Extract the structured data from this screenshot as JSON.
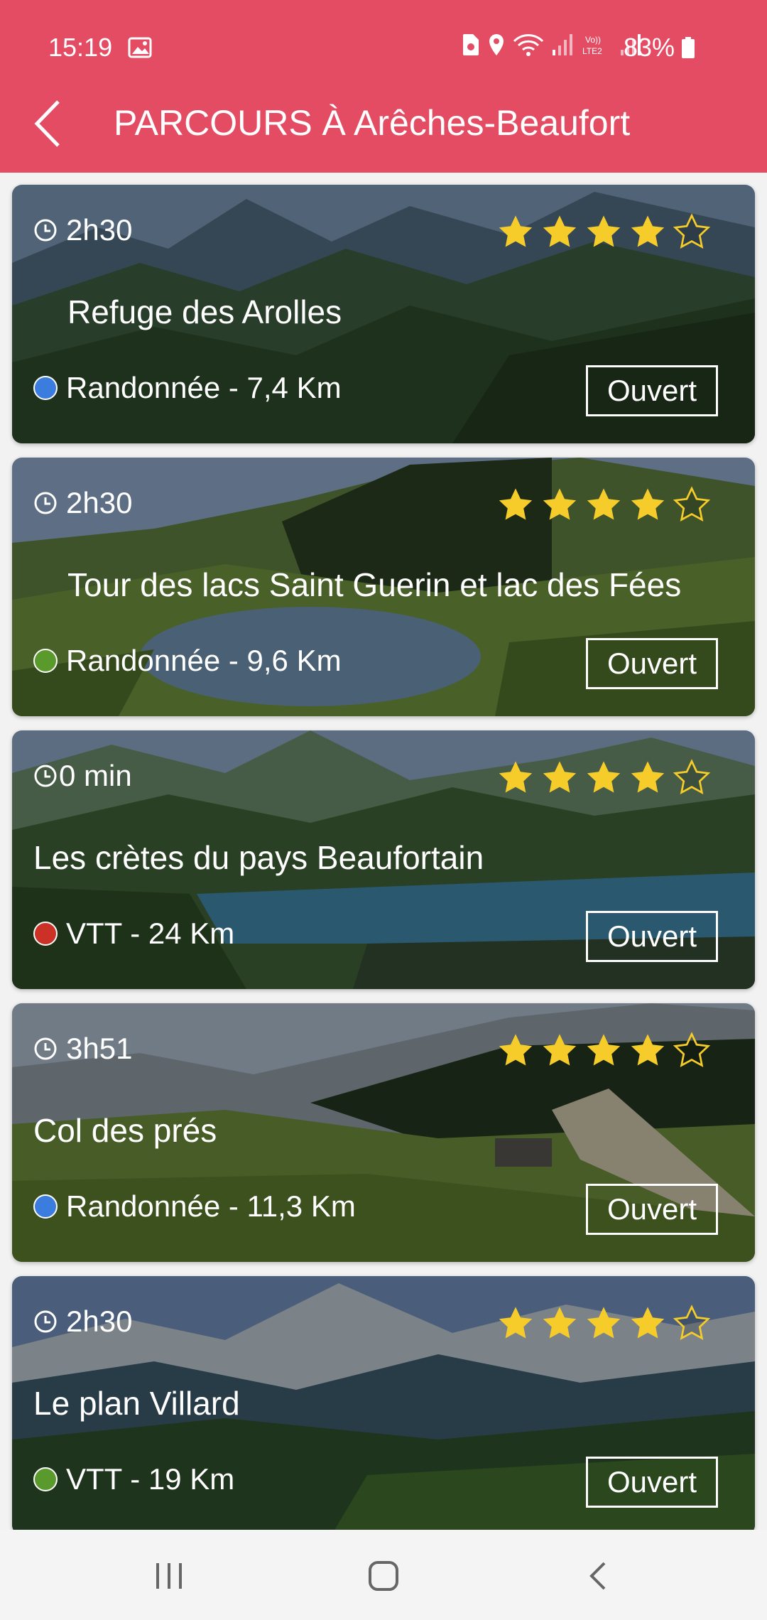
{
  "status_bar": {
    "time": "15:19",
    "battery": "83%"
  },
  "header": {
    "title": "PARCOURS À Arêches-Beaufort"
  },
  "routes": [
    {
      "duration": "2h30",
      "title": "Refuge des Arolles",
      "meta": "Randonnée - 7,4 Km",
      "dot_color": "#3b7cdf",
      "status": "Ouvert",
      "rating": 4
    },
    {
      "duration": "2h30",
      "title": "Tour des lacs Saint Guerin et lac des Fées",
      "meta": "Randonnée - 9,6 Km",
      "dot_color": "#5a9a2c",
      "status": "Ouvert",
      "rating": 4
    },
    {
      "duration": "0 min",
      "title": "Les crètes du pays Beaufortain",
      "meta": "VTT - 24 Km",
      "dot_color": "#cc3128",
      "status": "Ouvert",
      "rating": 4
    },
    {
      "duration": "3h51",
      "title": "Col des prés",
      "meta": "Randonnée - 11,3 Km",
      "dot_color": "#3b7cdf",
      "status": "Ouvert",
      "rating": 4
    },
    {
      "duration": "2h30",
      "title": "Le plan Villard",
      "meta": "VTT - 19 Km",
      "dot_color": "#5a9a2c",
      "status": "Ouvert",
      "rating": 4
    }
  ],
  "colors": {
    "header": "#e44c64",
    "star": "#f5cc2a"
  }
}
